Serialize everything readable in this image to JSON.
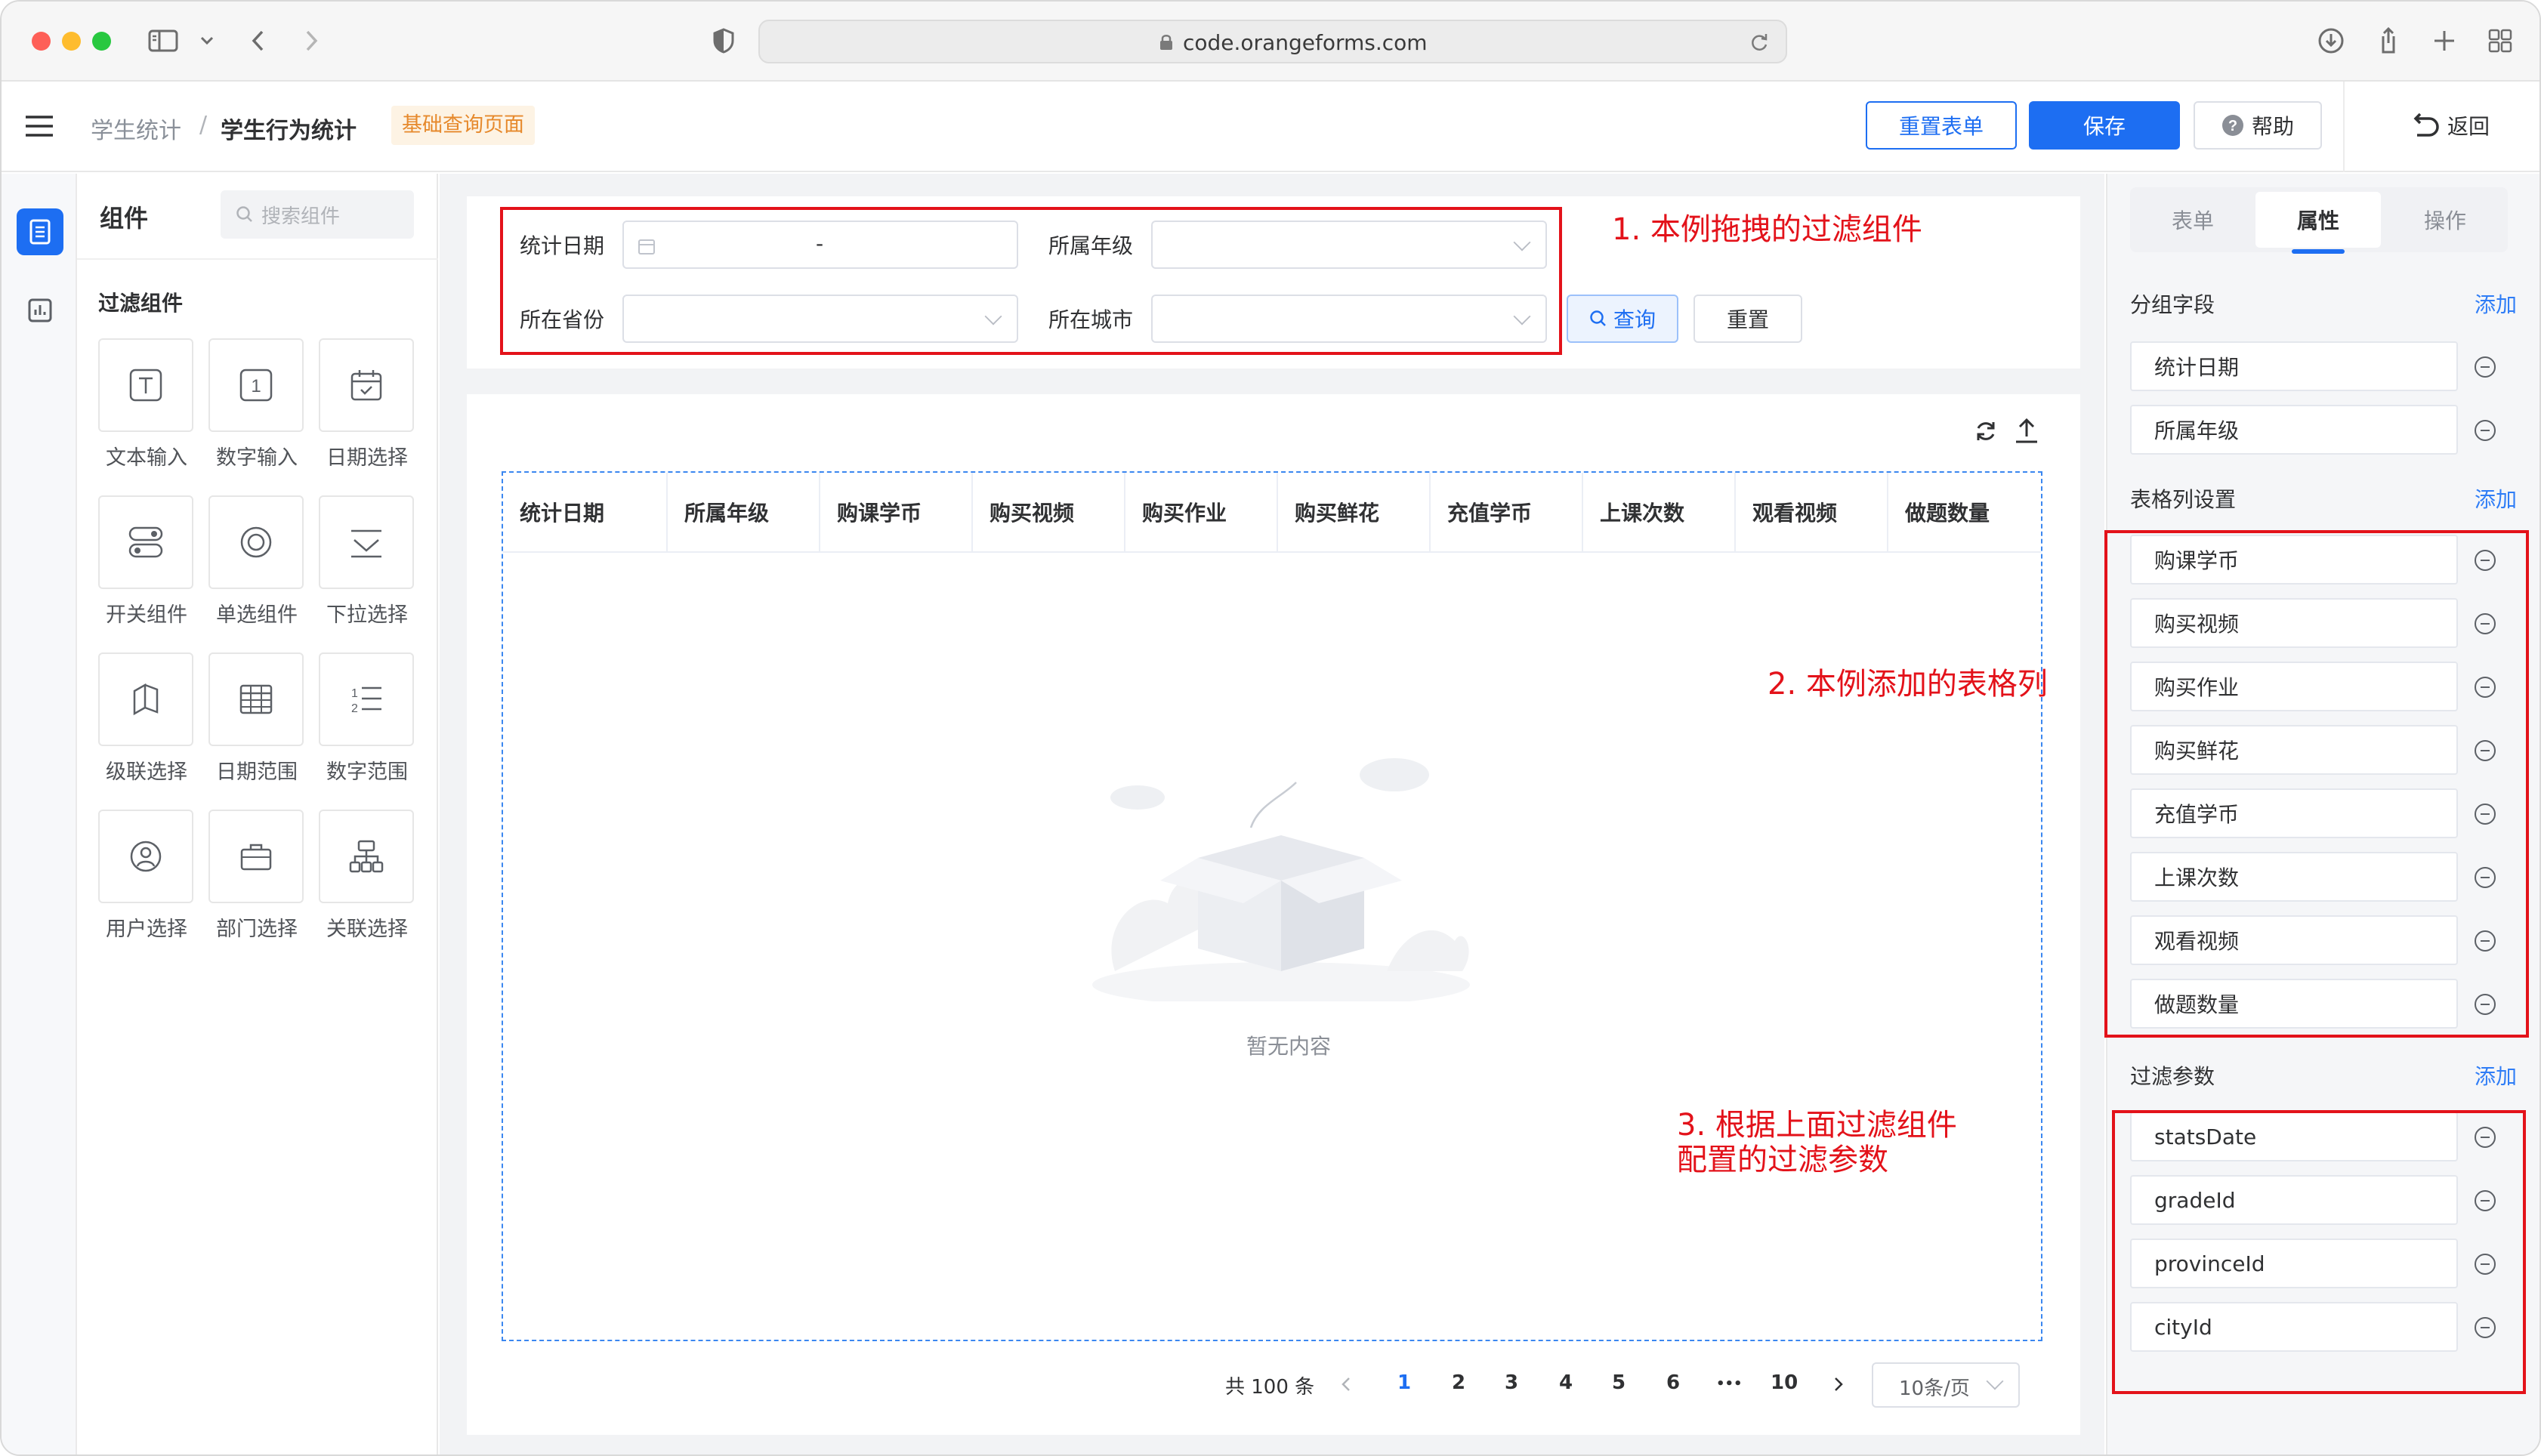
{
  "browser": {
    "url": "code.orangeforms.com"
  },
  "header": {
    "breadcrumb_parent": "学生统计",
    "breadcrumb_separator": "/",
    "breadcrumb_current": "学生行为统计",
    "page_tag": "基础查询页面",
    "reset_form_label": "重置表单",
    "save_label": "保存",
    "help_label": "帮助",
    "back_label": "返回",
    "accent_color": "#1d6ef2"
  },
  "components_panel": {
    "title": "组件",
    "search_placeholder": "搜索组件",
    "section_title": "过滤组件",
    "items": [
      {
        "label": "文本输入",
        "icon": "text-input-icon"
      },
      {
        "label": "数字输入",
        "icon": "number-input-icon"
      },
      {
        "label": "日期选择",
        "icon": "calendar-icon"
      },
      {
        "label": "开关组件",
        "icon": "switch-icon"
      },
      {
        "label": "单选组件",
        "icon": "radio-icon"
      },
      {
        "label": "下拉选择",
        "icon": "dropdown-icon"
      },
      {
        "label": "级联选择",
        "icon": "cascader-icon"
      },
      {
        "label": "日期范围",
        "icon": "date-range-icon"
      },
      {
        "label": "数字范围",
        "icon": "number-range-icon"
      },
      {
        "label": "用户选择",
        "icon": "user-icon"
      },
      {
        "label": "部门选择",
        "icon": "department-icon"
      },
      {
        "label": "关联选择",
        "icon": "relation-icon"
      }
    ]
  },
  "filter": {
    "stats_date_label": "统计日期",
    "date_separator": "-",
    "grade_label": "所属年级",
    "province_label": "所在省份",
    "city_label": "所在城市",
    "query_label": "查询",
    "reset_label": "重置"
  },
  "annotations": {
    "a1": "1. 本例拖拽的过滤组件",
    "a2": "2. 本例添加的表格列",
    "a3_line1": "3. 根据上面过滤组件",
    "a3_line2": "配置的过滤参数"
  },
  "table": {
    "columns": [
      "统计日期",
      "所属年级",
      "购课学币",
      "购买视频",
      "购买作业",
      "购买鲜花",
      "充值学币",
      "上课次数",
      "观看视频",
      "做题数量"
    ],
    "empty_text": "暂无内容"
  },
  "pagination": {
    "total_text": "共 100 条",
    "pages": [
      "1",
      "2",
      "3",
      "4",
      "5",
      "6"
    ],
    "ellipsis": "•••",
    "last_page": "10",
    "current_page": "1",
    "page_size": "10条/页"
  },
  "properties_panel": {
    "tabs": [
      "表单",
      "属性",
      "操作"
    ],
    "active_tab": "属性",
    "group_fields_title": "分组字段",
    "group_fields": [
      "统计日期",
      "所属年级"
    ],
    "table_columns_title": "表格列设置",
    "table_columns": [
      "购课学币",
      "购买视频",
      "购买作业",
      "购买鲜花",
      "充值学币",
      "上课次数",
      "观看视频",
      "做题数量"
    ],
    "filter_params_title": "过滤参数",
    "filter_params": [
      "statsDate",
      "gradeId",
      "provinceId",
      "cityId"
    ],
    "add_label": "添加"
  }
}
